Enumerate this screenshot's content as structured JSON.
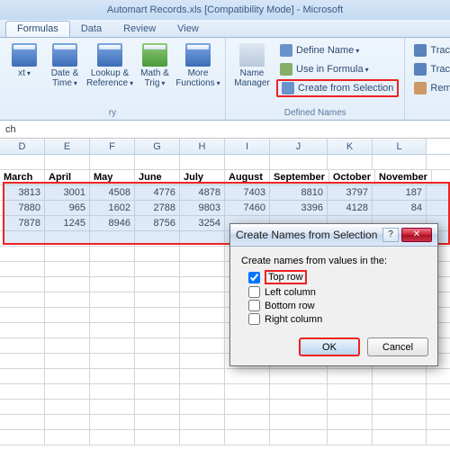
{
  "titlebar": "Automart Records.xls [Compatibility Mode] - Microsoft",
  "tabs": {
    "formulas": "Formulas",
    "data": "Data",
    "review": "Review",
    "view": "View"
  },
  "ribbon": {
    "lib": {
      "text": "xt",
      "datetime": "Date & Time",
      "lookup": "Lookup & Reference",
      "math": "Math & Trig",
      "more": "More Functions",
      "group": "ry"
    },
    "names": {
      "manager": "Name Manager",
      "define": "Define Name",
      "use": "Use in Formula",
      "create": "Create from Selection",
      "group": "Defined Names"
    },
    "audit": {
      "precede": "Trace Preceder",
      "depend": "Trace Depend",
      "remove": "Remove Arrow"
    }
  },
  "namebox": "ch",
  "cols": [
    "D",
    "E",
    "F",
    "G",
    "H",
    "I",
    "J",
    "K",
    "L"
  ],
  "table": {
    "headers": [
      "March",
      "April",
      "May",
      "June",
      "July",
      "August",
      "September",
      "October",
      "November"
    ],
    "rows": [
      [
        "3813",
        "3001",
        "4508",
        "4776",
        "4878",
        "7403",
        "8810",
        "3797",
        "187"
      ],
      [
        "7880",
        "965",
        "1602",
        "2788",
        "9803",
        "7460",
        "3396",
        "4128",
        "84"
      ],
      [
        "7878",
        "1245",
        "8946",
        "8756",
        "3254",
        "",
        "",
        "",
        ""
      ]
    ]
  },
  "dialog": {
    "title": "Create Names from Selection",
    "prompt": "Create names from values in the:",
    "top": "Top row",
    "left": "Left column",
    "bottom": "Bottom row",
    "right": "Right column",
    "ok": "OK",
    "cancel": "Cancel"
  }
}
